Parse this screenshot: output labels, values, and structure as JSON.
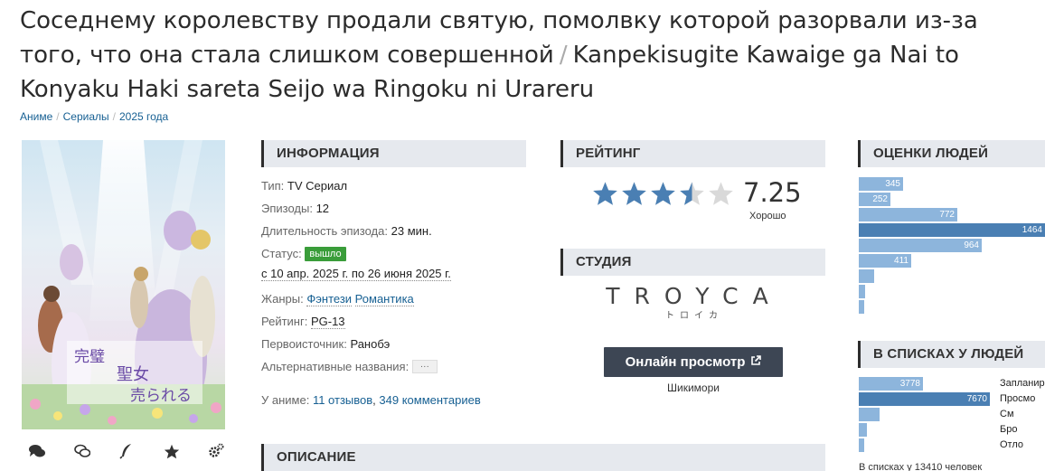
{
  "title": {
    "ru": "Соседнему королевству продали святую, помолвку которой разорвали из-за того, что она стала слишком совершенной",
    "separator": "/",
    "romaji": "Kanpekisugite Kawaige ga Nai to Konyaku Haki sareta Seijo wa Ringoku ni Urareru"
  },
  "breadcrumbs": [
    "Аниме",
    "Сериалы",
    "2025 года"
  ],
  "sections": {
    "info": "Информация",
    "rating": "Рейтинг",
    "studio": "Студия",
    "description": "Описание",
    "scores": "Оценки людей",
    "lists": "В списках у людей"
  },
  "info": {
    "type_label": "Тип:",
    "type_value": "TV Сериал",
    "episodes_label": "Эпизоды:",
    "episodes_value": "12",
    "duration_label": "Длительность эпизода:",
    "duration_value": "23 мин.",
    "status_label": "Статус:",
    "status_badge": "вышло",
    "dates": "с 10 апр. 2025 г. по 26 июня 2025 г.",
    "genres_label": "Жанры:",
    "genres": [
      "Фэнтези",
      "Романтика"
    ],
    "rating_label": "Рейтинг:",
    "rating_value": "PG-13",
    "source_label": "Первоисточник:",
    "source_value": "Ранобэ",
    "alt_label": "Альтернативные названия:",
    "alt_button": "···",
    "anime_label": "У аниме:",
    "reviews": "11 отзывов",
    "comments": "349 комментариев"
  },
  "rating": {
    "score": "7.25",
    "label": "Хорошо",
    "stars_filled": 3.5,
    "stars_total": 5,
    "star_color": "#4a7fb3"
  },
  "studio": {
    "name": "TROYCA",
    "name_kana": "トロイカ"
  },
  "watch": {
    "label": "Онлайн просмотр",
    "source": "Шикимори"
  },
  "scores": [
    {
      "value": 345,
      "label": "345"
    },
    {
      "value": 252,
      "label": "252"
    },
    {
      "value": 772,
      "label": "772"
    },
    {
      "value": 1464,
      "label": "1464"
    },
    {
      "value": 964,
      "label": "964"
    },
    {
      "value": 411,
      "label": "411"
    },
    {
      "value": 120,
      "label": ""
    },
    {
      "value": 50,
      "label": ""
    },
    {
      "value": 25,
      "label": ""
    }
  ],
  "lists": [
    {
      "value": 3778,
      "label": "3778",
      "name": "Запланир"
    },
    {
      "value": 7670,
      "label": "7670",
      "name": "Просмо"
    },
    {
      "value": 1200,
      "label": "",
      "name": "См"
    },
    {
      "value": 500,
      "label": "",
      "name": "Бро"
    },
    {
      "value": 150,
      "label": "",
      "name": "Отло"
    }
  ],
  "lists_footer": "В списках у 13410 человек",
  "poster_actions": [
    "comments-icon",
    "discuss-icon",
    "edit-icon",
    "favorite-icon",
    "settings-icon"
  ]
}
